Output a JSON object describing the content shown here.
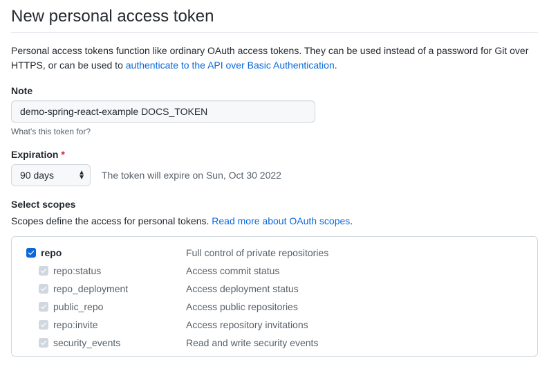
{
  "page_title": "New personal access token",
  "intro_prefix": "Personal access tokens function like ordinary OAuth access tokens. They can be used instead of a password for Git over HTTPS, or can be used to ",
  "intro_link": "authenticate to the API over Basic Authentication",
  "intro_suffix": ".",
  "note": {
    "label": "Note",
    "value": "demo-spring-react-example DOCS_TOKEN",
    "hint": "What's this token for?"
  },
  "expiration": {
    "label": "Expiration",
    "required_marker": "*",
    "selected": "90 days",
    "note": "The token will expire on Sun, Oct 30 2022"
  },
  "scopes": {
    "title": "Select scopes",
    "desc_prefix": "Scopes define the access for personal tokens. ",
    "link": "Read more about OAuth scopes",
    "link_suffix": ".",
    "items": [
      {
        "name": "repo",
        "desc": "Full control of private repositories",
        "level": "parent",
        "state": "checked"
      },
      {
        "name": "repo:status",
        "desc": "Access commit status",
        "level": "child",
        "state": "locked"
      },
      {
        "name": "repo_deployment",
        "desc": "Access deployment status",
        "level": "child",
        "state": "locked"
      },
      {
        "name": "public_repo",
        "desc": "Access public repositories",
        "level": "child",
        "state": "locked"
      },
      {
        "name": "repo:invite",
        "desc": "Access repository invitations",
        "level": "child",
        "state": "locked"
      },
      {
        "name": "security_events",
        "desc": "Read and write security events",
        "level": "child",
        "state": "locked"
      }
    ]
  }
}
